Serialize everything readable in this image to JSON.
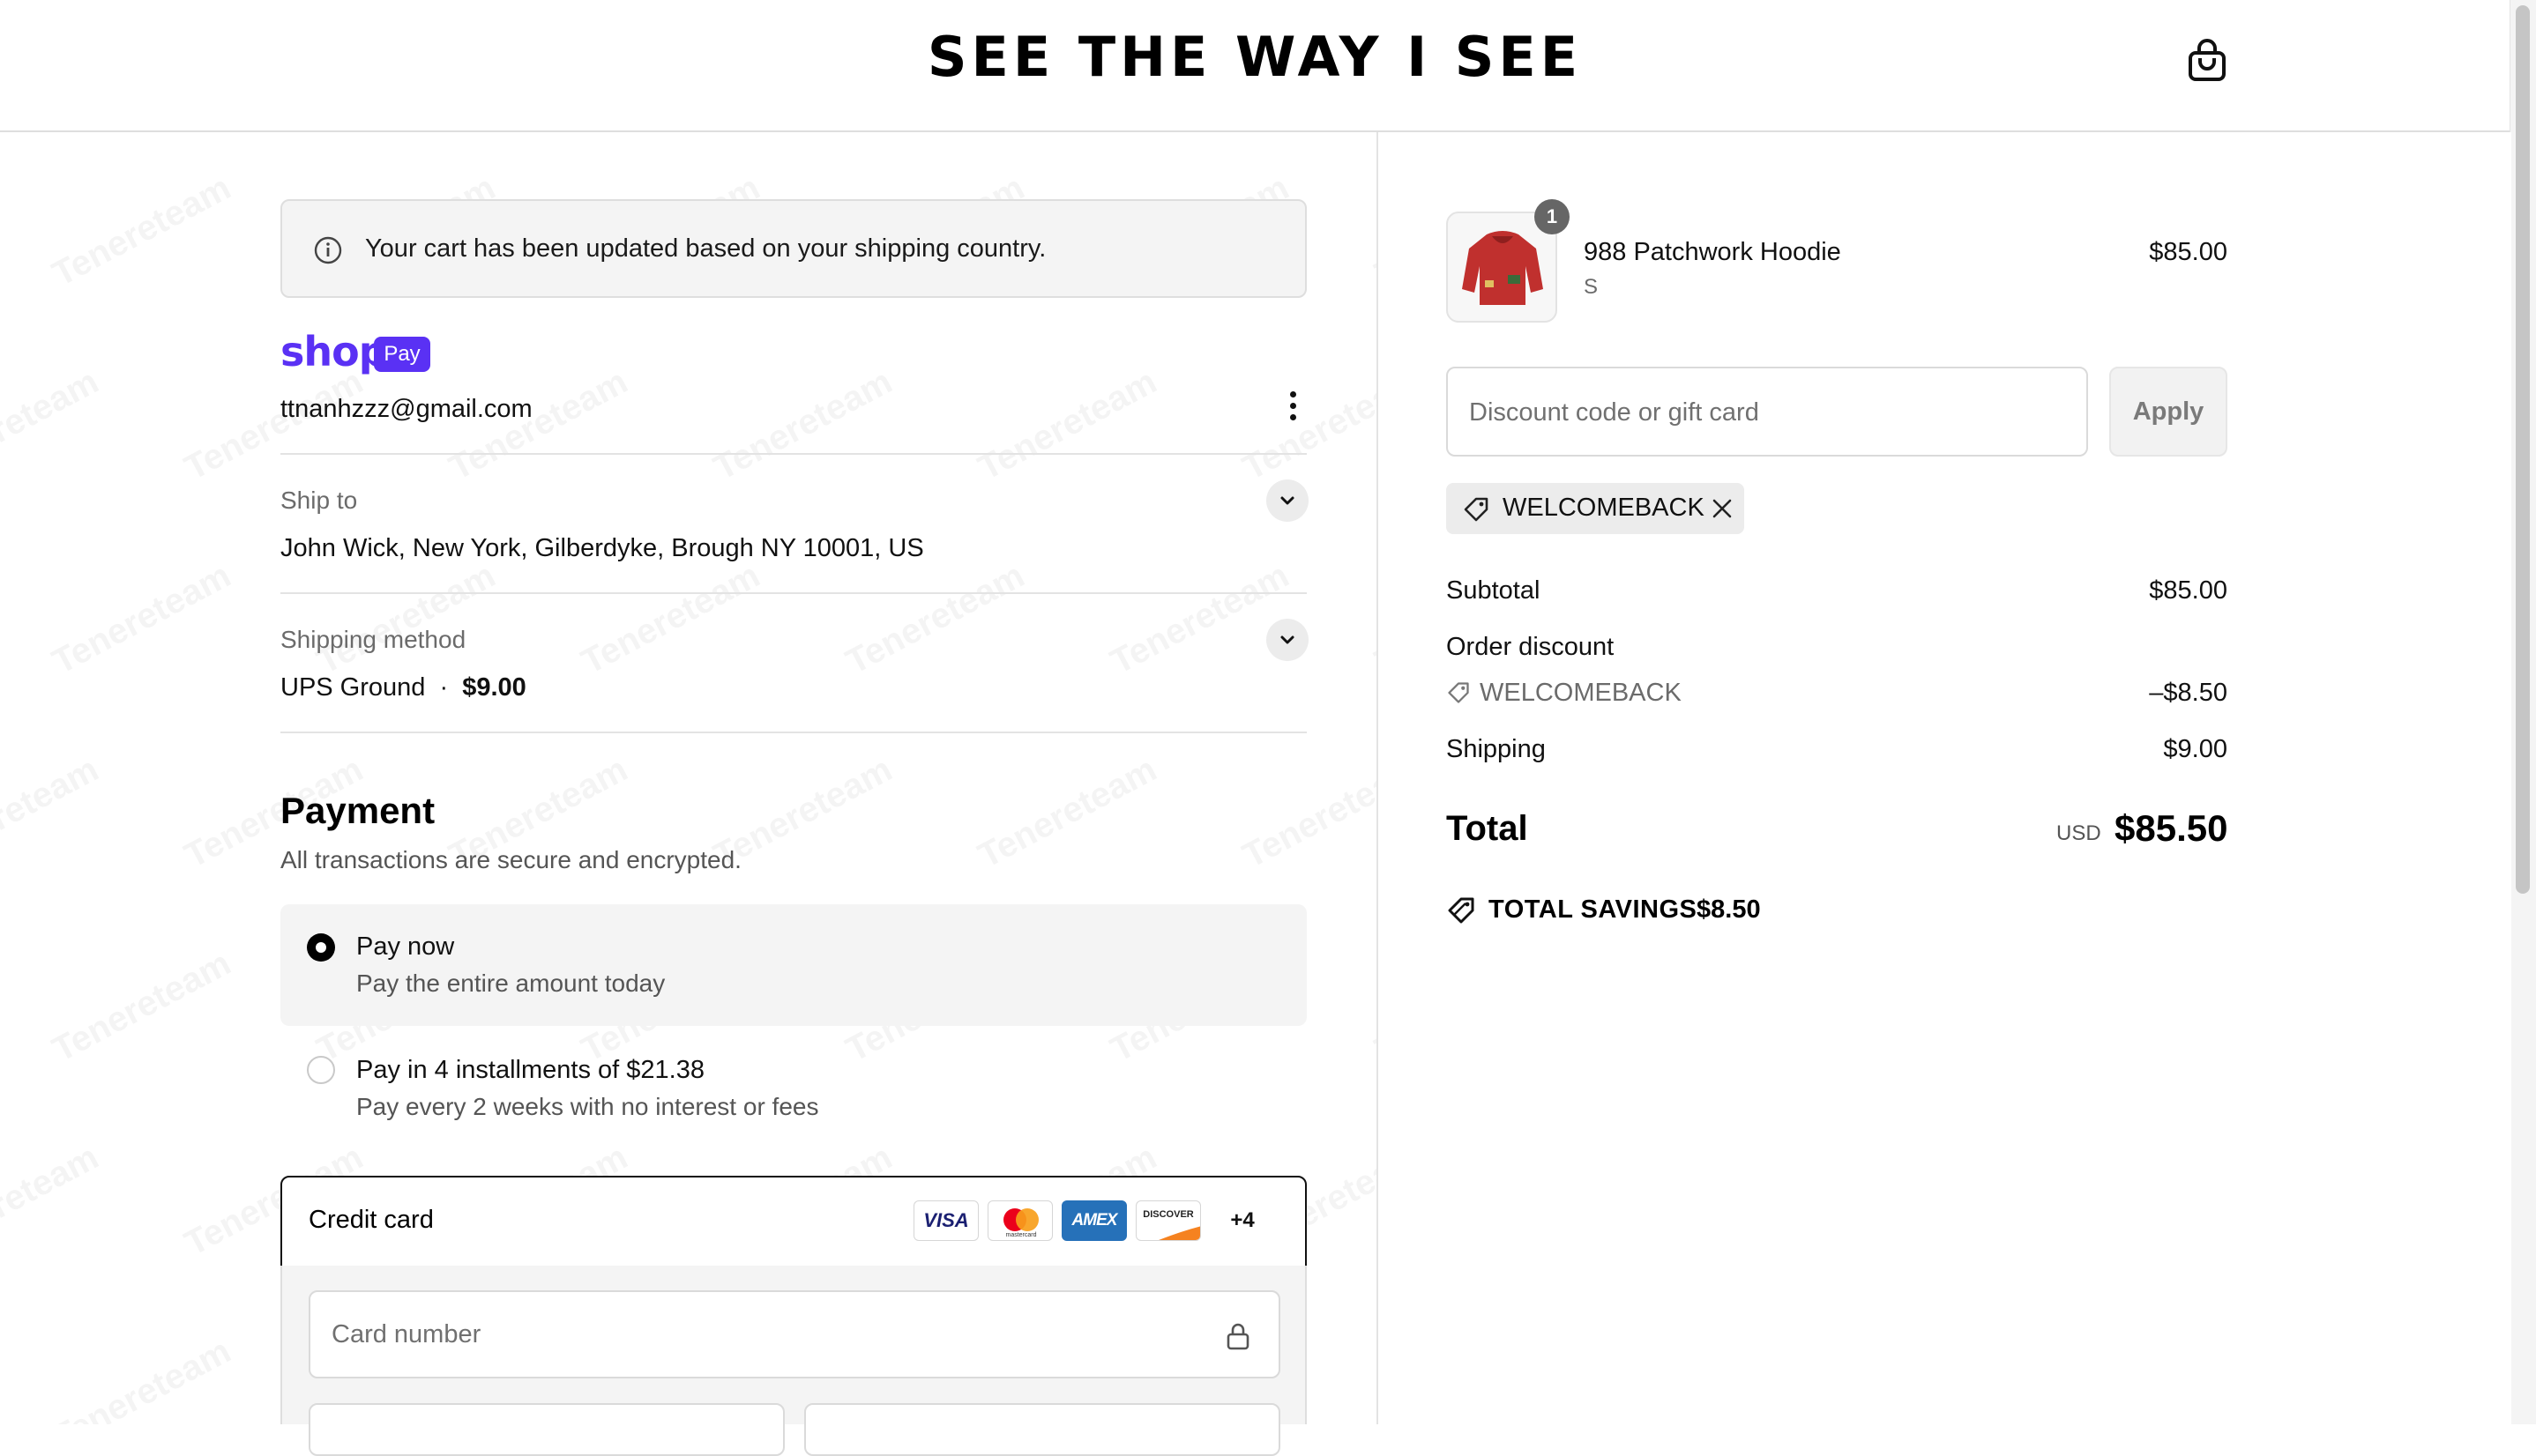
{
  "header": {
    "brand": "SEE THE WAY I SEE"
  },
  "notice": {
    "text": "Your cart has been updated based on your shipping country."
  },
  "shop_pay": {
    "word": "shop",
    "pill": "Pay"
  },
  "account": {
    "email": "ttnanhzzz@gmail.com"
  },
  "ship_to": {
    "label": "Ship to",
    "value": "John Wick, New York, Gilberdyke, Brough NY 10001, US"
  },
  "shipping_method": {
    "label": "Shipping method",
    "name": "UPS Ground",
    "separator": "·",
    "price": "$9.00"
  },
  "payment": {
    "heading": "Payment",
    "subheading": "All transactions are secure and encrypted.",
    "options": [
      {
        "title": "Pay now",
        "subtitle": "Pay the entire amount today",
        "selected": true
      },
      {
        "title": "Pay in 4 installments of $21.38",
        "subtitle": "Pay every 2 weeks with no interest or fees",
        "selected": false
      }
    ],
    "credit_card": {
      "label": "Credit card",
      "brands": [
        "VISA",
        "mastercard",
        "AMEX",
        "DISCOVER"
      ],
      "more": "+4",
      "card_number_placeholder": "Card number"
    }
  },
  "summary": {
    "item": {
      "name": "988 Patchwork Hoodie",
      "variant": "S",
      "price": "$85.00",
      "quantity": "1"
    },
    "discount_placeholder": "Discount code or gift card",
    "apply_label": "Apply",
    "applied_code": "WELCOMEBACK",
    "subtotal_label": "Subtotal",
    "subtotal_value": "$85.00",
    "order_discount_label": "Order discount",
    "order_discount_code": "WELCOMEBACK",
    "order_discount_value": "–$8.50",
    "shipping_label": "Shipping",
    "shipping_value": "$9.00",
    "total_label": "Total",
    "currency": "USD",
    "total_value": "$85.50",
    "savings_label": "TOTAL SAVINGS",
    "savings_value": "$8.50"
  },
  "watermark": "Tenereteam",
  "colors": {
    "shop_pay_purple": "#5a31f4",
    "hoodie_red": "#c0302e",
    "amex_blue": "#2671b9"
  }
}
